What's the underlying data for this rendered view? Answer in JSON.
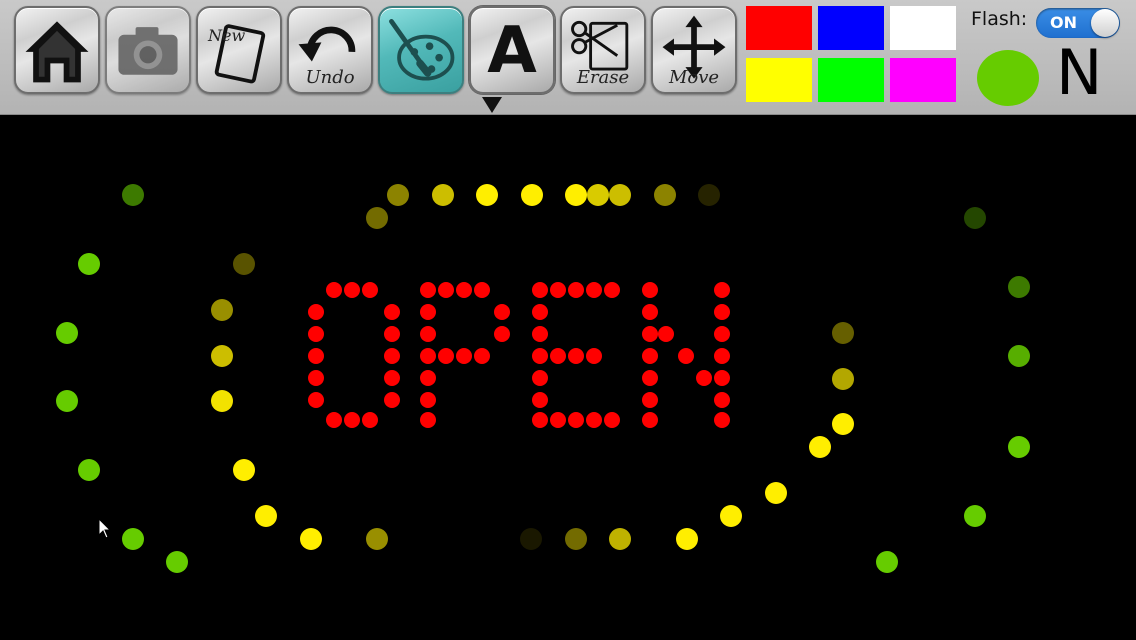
{
  "toolbar": {
    "buttons": [
      {
        "id": "home",
        "label": "",
        "icon": "home-icon"
      },
      {
        "id": "camera",
        "label": "",
        "icon": "camera-icon"
      },
      {
        "id": "new",
        "label": "New",
        "icon": "new-page-icon"
      },
      {
        "id": "undo",
        "label": "Undo",
        "icon": "undo-icon"
      },
      {
        "id": "paint",
        "label": "",
        "icon": "palette-icon"
      },
      {
        "id": "text",
        "label": "",
        "icon": "letter-a-icon"
      },
      {
        "id": "erase",
        "label": "Erase",
        "icon": "scissors-icon"
      },
      {
        "id": "move",
        "label": "Move",
        "icon": "move-arrows-icon"
      }
    ],
    "new_label": "New",
    "undo_label": "Undo",
    "erase_label": "Erase",
    "move_label": "Move",
    "text_button_letter": "A",
    "swatches": [
      "#ff0000",
      "#0000ff",
      "#ffffff",
      "#ffff00",
      "#00ff00",
      "#ff00ff"
    ],
    "flash_label": "Flash:",
    "flash_state": "ON",
    "current_color": "#66cc00",
    "direction_letter": "N"
  },
  "sign": {
    "text": "OPEN",
    "text_color": "#ff0000",
    "border_colors": {
      "yellow": "#ffee00",
      "green": "#66cc00"
    }
  }
}
